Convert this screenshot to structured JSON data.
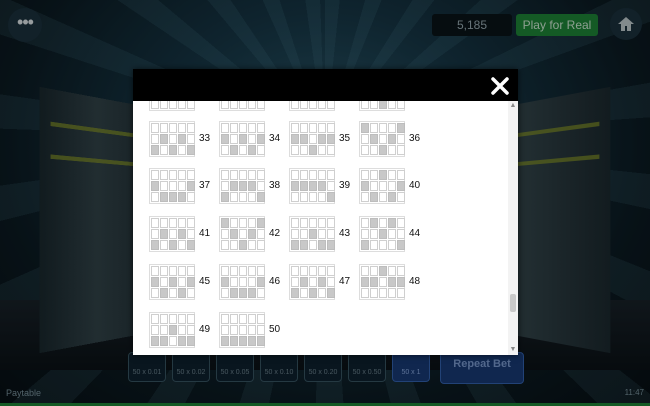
{
  "topbar": {
    "menu_icon": "ellipsis-icon",
    "balance": "5,185",
    "play_for_real": "Play for Real",
    "home_icon": "home-icon"
  },
  "bottombar": {
    "bets": [
      {
        "top": "BET",
        "value": "50 x 0.01"
      },
      {
        "top": "BET",
        "value": "50 x 0.02"
      },
      {
        "top": "BET",
        "value": "50 x 0.05"
      },
      {
        "top": "BET",
        "value": "50 x 0.10"
      },
      {
        "top": "BET",
        "value": "50 x 0.20"
      },
      {
        "top": "BET",
        "value": "50 x 0.50"
      },
      {
        "top": "BET",
        "value": "50 x 1"
      }
    ],
    "repeat_bet": "Repeat Bet",
    "paytable": "Paytable",
    "clock": "11:47"
  },
  "modal": {
    "close_icon": "close-icon",
    "paylines": [
      {
        "number": "33",
        "rows": [
          2,
          1,
          2,
          1,
          2
        ]
      },
      {
        "number": "34",
        "rows": [
          1,
          2,
          1,
          2,
          1
        ]
      },
      {
        "number": "35",
        "rows": [
          1,
          1,
          2,
          1,
          1
        ]
      },
      {
        "number": "36",
        "rows": [
          0,
          1,
          2,
          1,
          0
        ]
      },
      {
        "number": "37",
        "rows": [
          1,
          2,
          2,
          2,
          1
        ]
      },
      {
        "number": "38",
        "rows": [
          2,
          1,
          1,
          1,
          2
        ]
      },
      {
        "number": "39",
        "rows": [
          1,
          1,
          1,
          1,
          2
        ]
      },
      {
        "number": "40",
        "rows": [
          1,
          2,
          0,
          2,
          1
        ]
      },
      {
        "number": "41",
        "rows": [
          2,
          1,
          2,
          1,
          2
        ]
      },
      {
        "number": "42",
        "rows": [
          0,
          1,
          2,
          1,
          0
        ]
      },
      {
        "number": "43",
        "rows": [
          2,
          2,
          1,
          2,
          2
        ]
      },
      {
        "number": "44",
        "rows": [
          2,
          0,
          1,
          0,
          2
        ]
      },
      {
        "number": "45",
        "rows": [
          1,
          2,
          1,
          2,
          1
        ]
      },
      {
        "number": "46",
        "rows": [
          1,
          2,
          2,
          2,
          1
        ]
      },
      {
        "number": "47",
        "rows": [
          2,
          1,
          2,
          1,
          2
        ]
      },
      {
        "number": "48",
        "rows": [
          1,
          1,
          0,
          1,
          1
        ]
      },
      {
        "number": "49",
        "rows": [
          2,
          2,
          1,
          2,
          2
        ]
      },
      {
        "number": "50",
        "rows": [
          2,
          2,
          2,
          2,
          2
        ]
      }
    ]
  }
}
